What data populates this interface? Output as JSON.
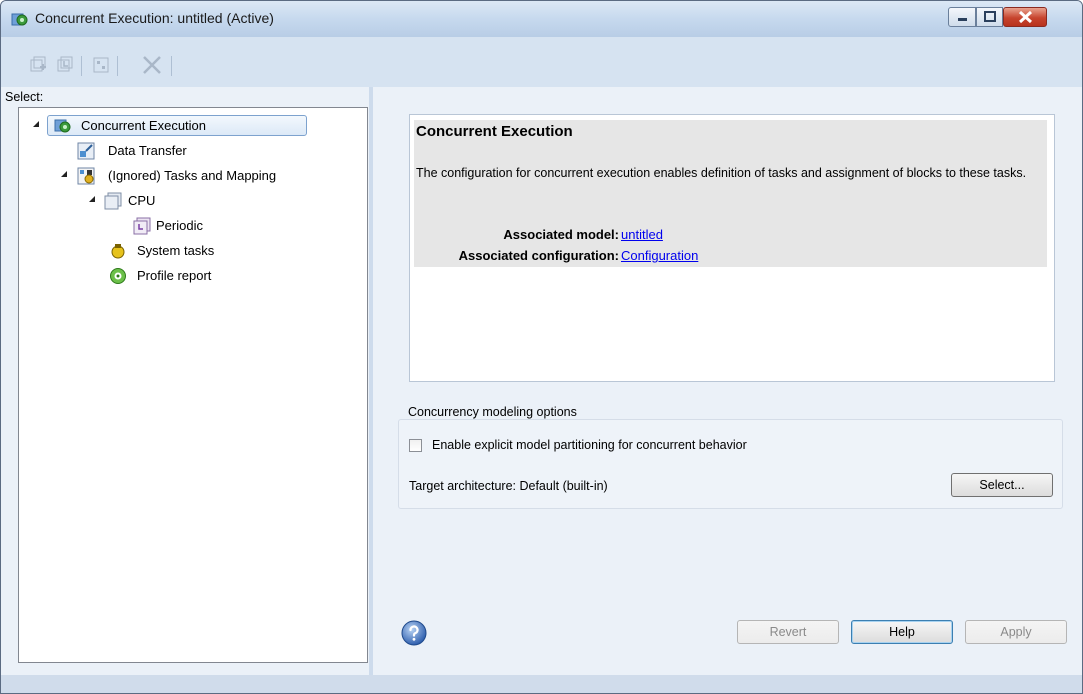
{
  "window": {
    "title": "Concurrent Execution: untitled (Active)",
    "controls": [
      "minimize-icon",
      "maximize-icon",
      "close-icon"
    ]
  },
  "toolbar": {
    "buttons": [
      "add-task-icon",
      "add-periodic-icon",
      "map-blocks-icon",
      "delete-icon"
    ]
  },
  "left": {
    "select_label": "Select:",
    "tree": [
      {
        "label": "Concurrent Execution",
        "icon": "concurrent-execution-icon",
        "selected": true,
        "expanded": true
      },
      {
        "label": "Data Transfer",
        "icon": "data-transfer-icon"
      },
      {
        "label": "(Ignored) Tasks and Mapping",
        "icon": "tasks-mapping-icon",
        "expanded": true
      },
      {
        "label": "CPU",
        "icon": "cpu-icon",
        "expanded": true
      },
      {
        "label": "Periodic",
        "icon": "periodic-icon"
      },
      {
        "label": "System tasks",
        "icon": "system-tasks-icon"
      },
      {
        "label": "Profile report",
        "icon": "profile-report-icon"
      }
    ]
  },
  "main": {
    "heading": "Concurrent Execution",
    "description": "The configuration for concurrent execution enables definition of tasks and assignment of blocks to these tasks.",
    "associated_model_label": "Associated model:",
    "associated_model_value": "untitled",
    "associated_configuration_label": "Associated configuration:",
    "associated_configuration_value": "Configuration",
    "group_label": "Concurrency modeling options",
    "checkbox_label": "Enable explicit model partitioning for concurrent behavior",
    "checkbox_checked": false,
    "target_architecture_label": "Target architecture:",
    "target_architecture_value": "Default (built-in)",
    "select_button": "Select..."
  },
  "footer": {
    "revert": "Revert",
    "help": "Help",
    "apply": "Apply"
  }
}
